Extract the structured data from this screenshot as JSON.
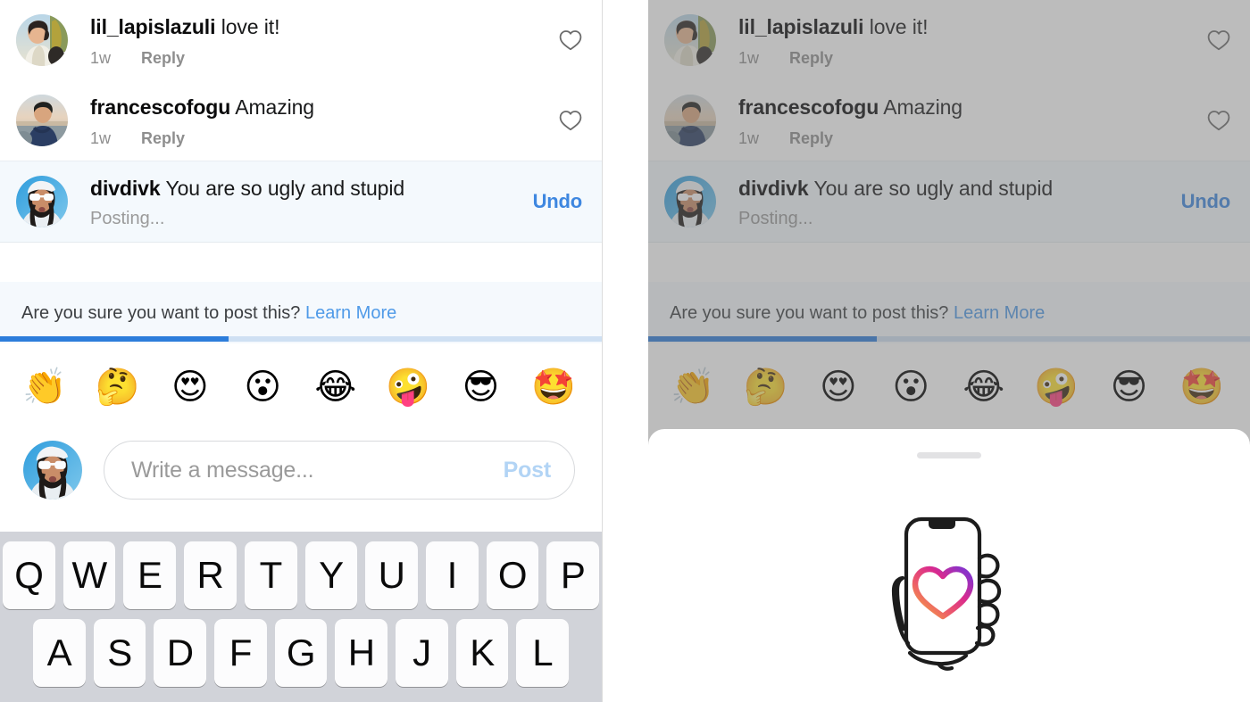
{
  "comments": [
    {
      "username": "lil_lapislazuli",
      "text": "love it!",
      "time": "1w",
      "reply_label": "Reply",
      "avatar": "avatar-lil-lapislazuli"
    },
    {
      "username": "francescofogu",
      "text": "Amazing",
      "time": "1w",
      "reply_label": "Reply",
      "avatar": "avatar-francescofogu"
    }
  ],
  "pending_comment": {
    "username": "divdivk",
    "text": "You are so ugly and stupid",
    "status": "Posting...",
    "undo_label": "Undo",
    "avatar": "avatar-divdivk"
  },
  "warning": {
    "message": "Are you sure you want to post this?",
    "learn_more_label": "Learn More"
  },
  "progress": {
    "percent": 38
  },
  "emoji_bar": {
    "emojis": [
      {
        "glyph": "👏",
        "name": "clapping-hands-emoji"
      },
      {
        "glyph": "🤔",
        "name": "thinking-face-emoji"
      },
      {
        "glyph": "😍",
        "name": "heart-eyes-emoji"
      },
      {
        "glyph": "😮",
        "name": "open-mouth-emoji"
      },
      {
        "glyph": "😂",
        "name": "tears-of-joy-emoji"
      },
      {
        "glyph": "🤪",
        "name": "zany-face-emoji"
      },
      {
        "glyph": "😎",
        "name": "sunglasses-face-emoji"
      },
      {
        "glyph": "🤩",
        "name": "star-struck-emoji"
      }
    ]
  },
  "composer": {
    "placeholder": "Write a message...",
    "post_label": "Post",
    "avatar": "avatar-divdivk"
  },
  "keyboard": {
    "row1": [
      "Q",
      "W",
      "E",
      "R",
      "T",
      "Y",
      "U",
      "I",
      "O",
      "P"
    ],
    "row2": [
      "A",
      "S",
      "D",
      "F",
      "G",
      "H",
      "J",
      "K",
      "L"
    ]
  },
  "bottom_sheet": {
    "illustration_name": "hand-holding-phone-with-heart-illustration"
  },
  "colors": {
    "accent_blue": "#3e87e0",
    "link_blue": "#4f9ae8",
    "progress_fill": "#2d7ddb",
    "progress_track": "#cfe0f3",
    "pending_row_bg": "#f4f9fd",
    "warning_bg": "#f5f9fd",
    "keyboard_bg": "#d1d3d9",
    "post_disabled": "#b2d4f5",
    "overlay_dim": "#6e6e6e"
  }
}
